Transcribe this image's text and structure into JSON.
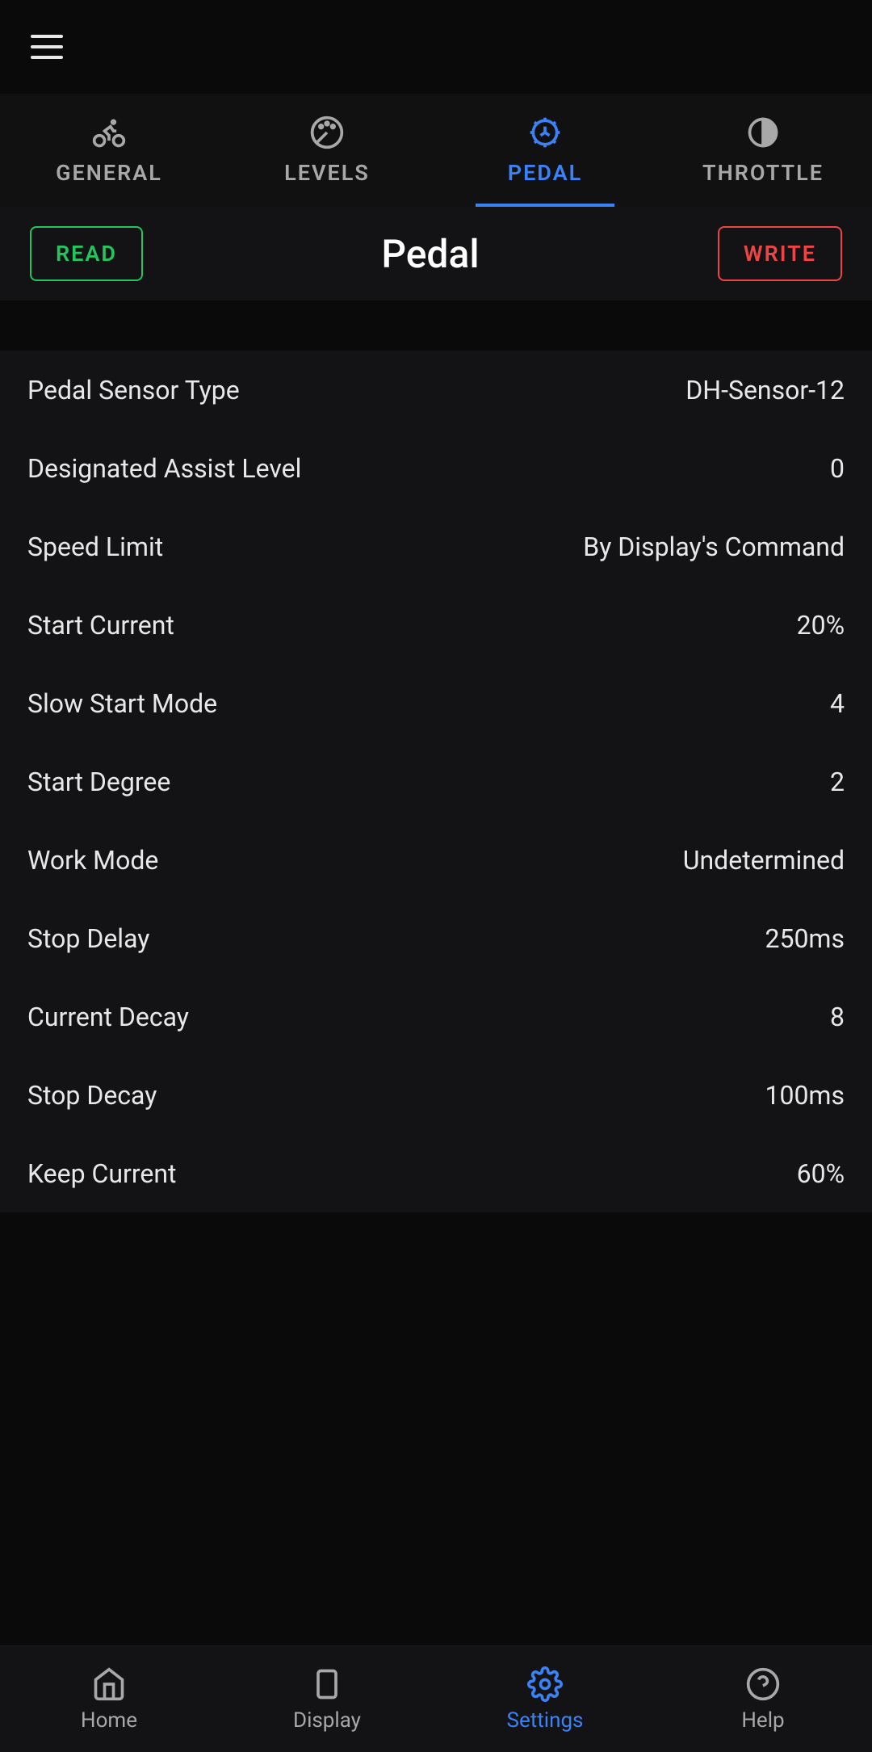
{
  "tabs": [
    {
      "label": "GENERAL"
    },
    {
      "label": "LEVELS"
    },
    {
      "label": "PEDAL"
    },
    {
      "label": "THROTTLE"
    }
  ],
  "action": {
    "read_label": "READ",
    "write_label": "WRITE",
    "title": "Pedal"
  },
  "settings": [
    {
      "label": "Pedal Sensor Type",
      "value": "DH-Sensor-12"
    },
    {
      "label": "Designated Assist Level",
      "value": "0"
    },
    {
      "label": "Speed Limit",
      "value": "By Display's Command"
    },
    {
      "label": "Start Current",
      "value": "20%"
    },
    {
      "label": "Slow Start Mode",
      "value": "4"
    },
    {
      "label": "Start Degree",
      "value": "2"
    },
    {
      "label": "Work Mode",
      "value": "Undetermined"
    },
    {
      "label": "Stop Delay",
      "value": "250ms"
    },
    {
      "label": "Current Decay",
      "value": "8"
    },
    {
      "label": "Stop Decay",
      "value": "100ms"
    },
    {
      "label": "Keep Current",
      "value": "60%"
    }
  ],
  "bottom_nav": [
    {
      "label": "Home"
    },
    {
      "label": "Display"
    },
    {
      "label": "Settings"
    },
    {
      "label": "Help"
    }
  ]
}
